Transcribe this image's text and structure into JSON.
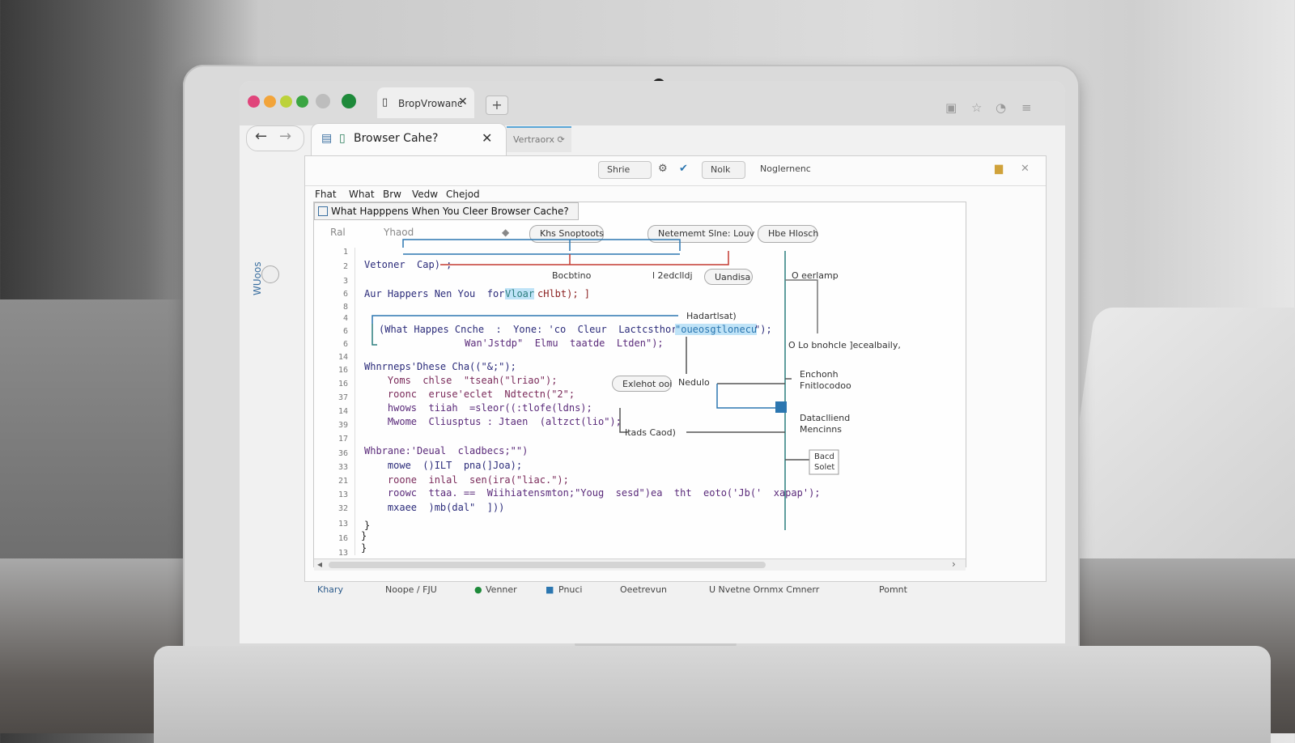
{
  "browser": {
    "top_tab_label": "BropVrowanc",
    "main_tab_label": "Browser Cahe?",
    "sub_tab_label": "Vertraorx ⟳",
    "new_tab": "+",
    "close": "✕",
    "back": "←",
    "forward": "→"
  },
  "toolbar": {
    "share_label": "Shrie",
    "note_label": "Nolk",
    "engineer_label": "Noglernenc"
  },
  "menu": [
    "Fhat",
    "What",
    "Brw",
    "Vedw",
    "Chejod"
  ],
  "document": {
    "title": "What Happpens When You Cleer Browser Cache?",
    "col_a": "Ral",
    "col_b": "Yhaod",
    "pill_snapshots": "Khs Snoptoots",
    "pill_network": "Netememt Slne: Louv",
    "pill_hbe": "Hbe Hlosch",
    "labels": {
      "bookshop": "Bocbtino",
      "zedding": "l 2edclldj",
      "unhisa": "Uandisa",
      "overlamp": "O eerlamp",
      "haderlsat": "Hadartlsat)",
      "lononicle": "O Lo bnohcle ]ecealbaily,",
      "exhelot": "Exlehot ooi",
      "nedulo": "Nedulo",
      "enchonh": "Enchonh",
      "enblocedo": "Fnitlocodoo",
      "datacliend": "Dataclliend",
      "mencinns": "Mencinns",
      "ftads_caod": "Itads Caod)",
      "bacd": "Bacd",
      "solet": "Solet"
    },
    "line_numbers": [
      "1",
      "2",
      "3",
      "6",
      "8",
      "4",
      "6",
      "6",
      "14",
      "16",
      "16",
      "37",
      "14",
      "39",
      "17",
      "36",
      "33",
      "21",
      "13",
      "32",
      "13",
      "16",
      "13"
    ],
    "code_lines": [
      "Vetoner  Cap) ;",
      "Aur Happers Nen You  fors'",
      "Vloar",
      "cHlbt); ]",
      "(What Happes Cnche  :  Yone: 'co  Cleur  Lactcsthorcet: ",
      "\"oueosgtlonecu",
      "\");",
      "Wan'Jstdp\"  Elmu  taatde  Ltden\");",
      "Whnrneps'Dhese Cha((\"&;\");",
      "    Yoms  chlse  \"tseah(\"lriao\");",
      "    roonc  eruse'eclet  Ndtectn(\"2\";",
      "    hwows  tiiah  =sleor((:tlofe(ldns);",
      "    Mwome  Cliusptus : Jtaen  (altzct(lio\");",
      "Whbrane:'Deual  cladbecs;\"\")",
      "    mowe  ()ILT  pna(]Joa);",
      "    roone  inlal  sen(ira(\"liac.\");",
      "    roowc  ttaa. ==  Wiihiatensmton;\"Youg  sesd\")ea  tht  eoto('Jb('  xapap');",
      "    mxaee  )mb(dal\"  ]))",
      "}",
      "}",
      "}"
    ]
  },
  "statusbar": [
    "Khary",
    "Noope  /  FJU",
    "Venner",
    "Pnuci",
    "Oeetrevun",
    "U  Nvetne  Ornmx  Cmnerr",
    "Pomnt"
  ],
  "side": {
    "label": "WUoos"
  },
  "colors": {
    "accent": "#3a6fa0",
    "red_line": "#c43a31",
    "blue_line": "#2b76b0",
    "teal_line": "#2a7d7d"
  }
}
